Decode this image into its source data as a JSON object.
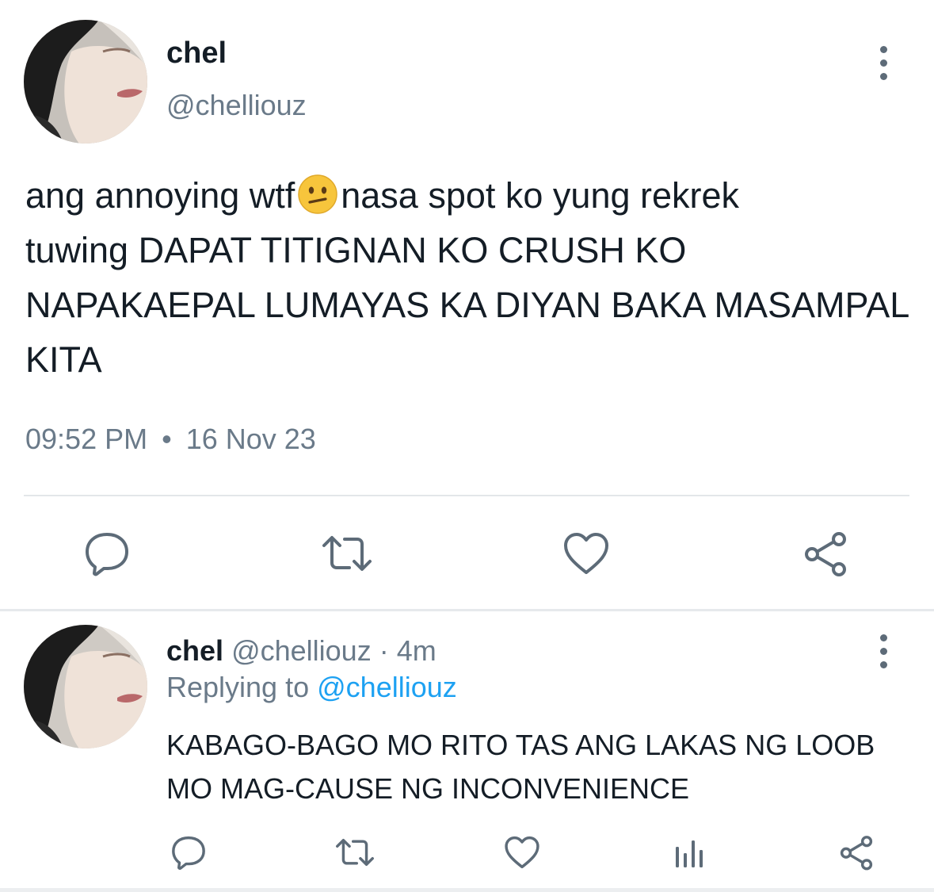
{
  "main_tweet": {
    "display_name": "chel",
    "handle": "@chelliouz",
    "text_before_emoji": "ang annoying wtf",
    "emoji": "confused-face-emoji",
    "text_after_emoji": "nasa spot ko yung rekrek\ntuwing DAPAT TITIGNAN KO CRUSH KO\nNAPAKAEPAL LUMAYAS KA DIYAN BAKA MASAMPAL\nKITA",
    "time": "09:52 PM",
    "separator": "•",
    "date": "16 Nov 23",
    "actions": [
      "reply-icon",
      "retweet-icon",
      "like-icon",
      "share-icon"
    ]
  },
  "reply_tweet": {
    "display_name": "chel",
    "handle": "@chelliouz",
    "age": "· 4m",
    "replying_label": "Replying to",
    "replying_mention": "@chelliouz",
    "text": "KABAGO-BAGO MO RITO TAS ANG LAKAS NG LOOB MO MAG-CAUSE NG INCONVENIENCE",
    "actions": [
      "reply-icon",
      "retweet-icon",
      "like-icon",
      "stats-icon",
      "share-icon"
    ]
  },
  "colors": {
    "text": "#141d26",
    "secondary": "#6a7a89",
    "icon": "#5d6b78",
    "mention": "#1da1f2",
    "divider": "#e3e6e9"
  }
}
